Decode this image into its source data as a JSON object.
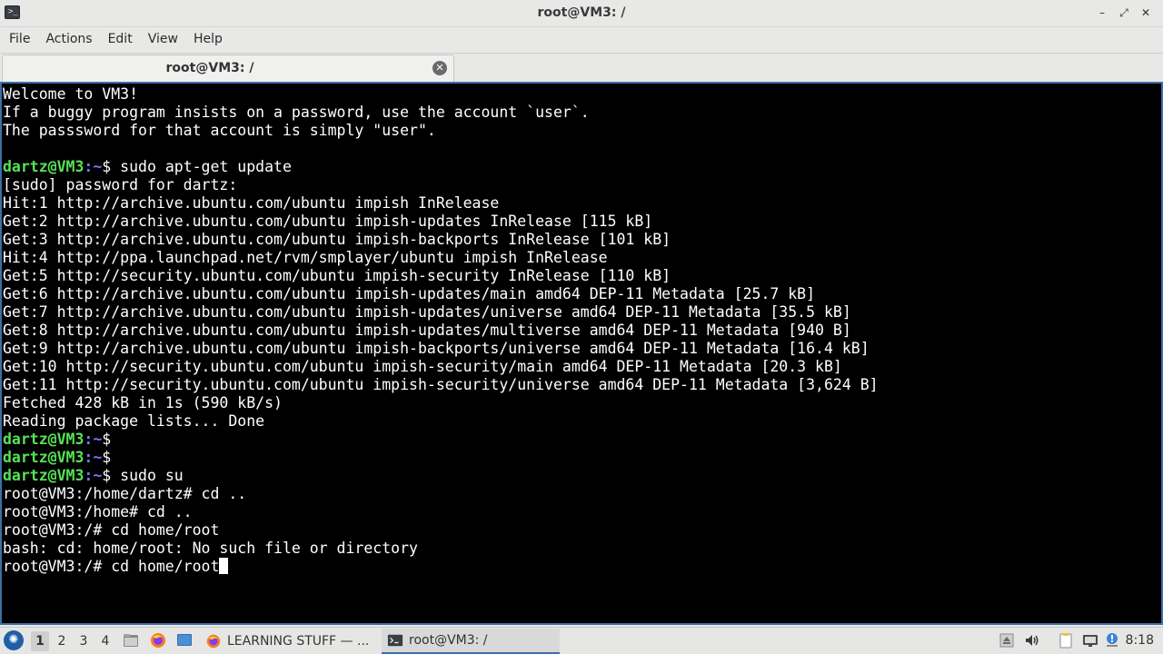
{
  "window": {
    "title": "root@VM3: /",
    "app_icon_glyph": ">_",
    "minimize_glyph": "–",
    "maximize_glyph": "⤢",
    "close_glyph": "✕"
  },
  "menubar": {
    "items": [
      "File",
      "Actions",
      "Edit",
      "View",
      "Help"
    ]
  },
  "tabs": [
    {
      "label": "root@VM3: /",
      "close_glyph": "✕"
    }
  ],
  "terminal": {
    "colors": {
      "background": "#000000",
      "text": "#ffffff",
      "prompt_user": "#55e355",
      "prompt_path": "#6f7bff"
    },
    "lines": [
      {
        "text": "Welcome to VM3!"
      },
      {
        "text": "If a buggy program insists on a password, use the account `user`."
      },
      {
        "text": "The passsword for that account is simply \"user\"."
      },
      {
        "text": ""
      },
      {
        "prompt_user": "dartz@VM3",
        "prompt_path": ":~",
        "prompt_sym": "$ ",
        "text": "sudo apt-get update"
      },
      {
        "text": "[sudo] password for dartz:"
      },
      {
        "text": "Hit:1 http://archive.ubuntu.com/ubuntu impish InRelease"
      },
      {
        "text": "Get:2 http://archive.ubuntu.com/ubuntu impish-updates InRelease [115 kB]"
      },
      {
        "text": "Get:3 http://archive.ubuntu.com/ubuntu impish-backports InRelease [101 kB]"
      },
      {
        "text": "Hit:4 http://ppa.launchpad.net/rvm/smplayer/ubuntu impish InRelease"
      },
      {
        "text": "Get:5 http://security.ubuntu.com/ubuntu impish-security InRelease [110 kB]"
      },
      {
        "text": "Get:6 http://archive.ubuntu.com/ubuntu impish-updates/main amd64 DEP-11 Metadata [25.7 kB]"
      },
      {
        "text": "Get:7 http://archive.ubuntu.com/ubuntu impish-updates/universe amd64 DEP-11 Metadata [35.5 kB]"
      },
      {
        "text": "Get:8 http://archive.ubuntu.com/ubuntu impish-updates/multiverse amd64 DEP-11 Metadata [940 B]"
      },
      {
        "text": "Get:9 http://archive.ubuntu.com/ubuntu impish-backports/universe amd64 DEP-11 Metadata [16.4 kB]"
      },
      {
        "text": "Get:10 http://security.ubuntu.com/ubuntu impish-security/main amd64 DEP-11 Metadata [20.3 kB]"
      },
      {
        "text": "Get:11 http://security.ubuntu.com/ubuntu impish-security/universe amd64 DEP-11 Metadata [3,624 B]"
      },
      {
        "text": "Fetched 428 kB in 1s (590 kB/s)"
      },
      {
        "text": "Reading package lists... Done"
      },
      {
        "prompt_user": "dartz@VM3",
        "prompt_path": ":~",
        "prompt_sym": "$",
        "text": ""
      },
      {
        "prompt_user": "dartz@VM3",
        "prompt_path": ":~",
        "prompt_sym": "$",
        "text": ""
      },
      {
        "prompt_user": "dartz@VM3",
        "prompt_path": ":~",
        "prompt_sym": "$ ",
        "text": "sudo su"
      },
      {
        "text": "root@VM3:/home/dartz# cd .."
      },
      {
        "text": "root@VM3:/home# cd .."
      },
      {
        "text": "root@VM3:/# cd home/root"
      },
      {
        "text": "bash: cd: home/root: No such file or directory"
      },
      {
        "text": "root@VM3:/# cd home/root",
        "cursor": true
      }
    ]
  },
  "taskbar": {
    "start_glyph": "✺",
    "workspaces": [
      "1",
      "2",
      "3",
      "4"
    ],
    "active_workspace": "1",
    "tasks": [
      {
        "label": "LEARNING STUFF — ...",
        "icon": "firefox-icon",
        "active": false
      },
      {
        "label": "root@VM3: /",
        "icon": "terminal-icon",
        "active": true
      }
    ],
    "clock": "8:18",
    "tray_icons": [
      "eject-icon",
      "volume-icon",
      "clipboard-icon",
      "network-icon",
      "update-icon",
      "power-icon"
    ]
  }
}
